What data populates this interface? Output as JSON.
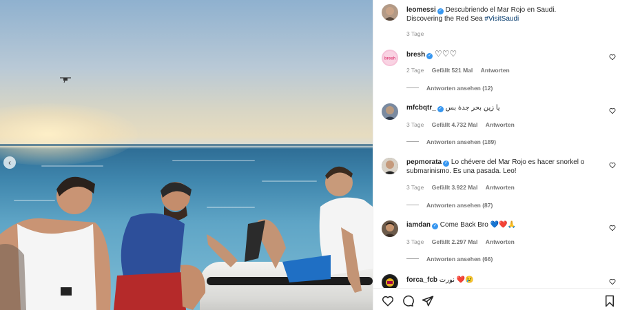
{
  "post": {
    "author": "leomessi",
    "caption_line1": "Descubriendo el Mar Rojo en Saudi.",
    "caption_line2": "Discovering the Red Sea",
    "hashtag": "#VisitSaudi",
    "time": "3 Tage"
  },
  "comments": [
    {
      "user": "bresh",
      "text": "♡♡♡",
      "time": "2 Tage",
      "likes": "Gefällt 521 Mal",
      "reply": "Antworten",
      "view_replies": "Antworten ansehen (12)",
      "avatar_color": "#f6b6d1",
      "avatar_label": "bresh"
    },
    {
      "user": "mfcbqtr_",
      "text": "يا زين بحر جدة بس",
      "time": "3 Tage",
      "likes": "Gefällt 4.732 Mal",
      "reply": "Antworten",
      "view_replies": "Antworten ansehen (189)",
      "avatar_color": "#7a8aa0"
    },
    {
      "user": "pepmorata",
      "text_line1": "Lo chévere del Mar Rojo es hacer snorkel o",
      "text_line2": "submarinismo. Es una pasada. Leo!",
      "time": "3 Tage",
      "likes": "Gefällt 3.922 Mal",
      "reply": "Antworten",
      "view_replies": "Antworten ansehen (87)",
      "avatar_color": "#4a4a4a"
    },
    {
      "user": "iamdan",
      "text": "Come Back Bro",
      "text_emoji": "💙❤️🙏",
      "time": "3 Tage",
      "likes": "Gefällt 2.297 Mal",
      "reply": "Antworten",
      "view_replies": "Antworten ansehen (66)",
      "avatar_color": "#6b5a4a"
    },
    {
      "user": "forca_fcb",
      "text": "نورت ❤️😢",
      "avatar_color": "#222222"
    }
  ],
  "colors": {
    "verified": "#3897f0",
    "meta": "#8e8e8e",
    "text": "#262626"
  },
  "icons": {
    "like": "heart-icon",
    "comment": "comment-icon",
    "share": "send-icon",
    "save": "bookmark-icon",
    "prev": "chevron-left-icon"
  }
}
